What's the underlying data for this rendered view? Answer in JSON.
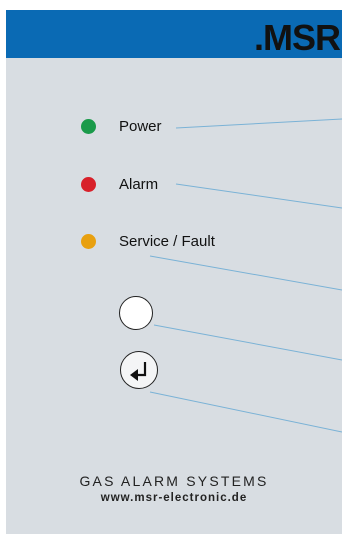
{
  "brand": {
    "logo_text": ".MSR",
    "header_color": "#0a6ab4"
  },
  "indicators": [
    {
      "name": "power",
      "label": "Power",
      "color": "#1a9a4a"
    },
    {
      "name": "alarm",
      "label": "Alarm",
      "color": "#d8202a"
    },
    {
      "name": "service-fault",
      "label": "Service / Fault",
      "color": "#e8a010"
    }
  ],
  "buttons": {
    "round": {
      "icon": "circle-button-icon"
    },
    "enter": {
      "icon": "enter-return-icon"
    }
  },
  "footer": {
    "title": "GAS ALARM SYSTEMS",
    "url": "www.msr-electronic.de"
  },
  "colors": {
    "leader_line": "#7ab2d6",
    "panel": "#d8dde2"
  }
}
